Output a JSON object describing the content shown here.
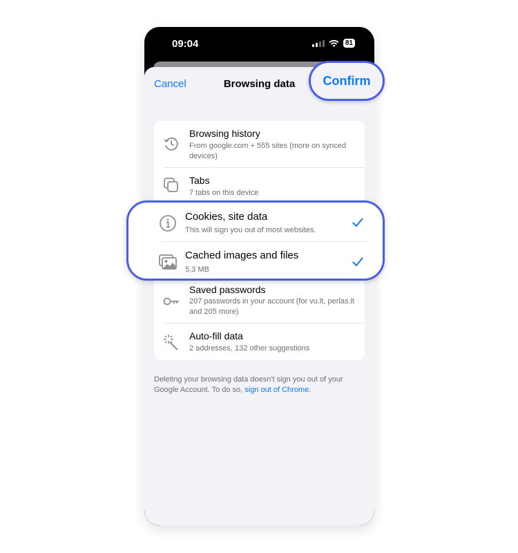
{
  "status_bar": {
    "time": "09:04",
    "battery": "81"
  },
  "nav": {
    "cancel_label": "Cancel",
    "title": "Browsing data",
    "confirm_label": "Confirm"
  },
  "items": [
    {
      "title": "Browsing history",
      "subtitle": "From google.com + 555 sites (more on synced devices)",
      "icon": "history-icon",
      "checked": false
    },
    {
      "title": "Tabs",
      "subtitle": "7 tabs on this device",
      "icon": "tabs-icon",
      "checked": false
    },
    {
      "title": "Cookies, site data",
      "subtitle": "This will sign you out of most websites.",
      "icon": "info-icon",
      "checked": true
    },
    {
      "title": "Cached images and files",
      "subtitle": "5,3 MB",
      "icon": "images-icon",
      "checked": true
    },
    {
      "title": "Saved passwords",
      "subtitle": "207 passwords in your account (for vu.lt, perlas.lt and 205 more)",
      "icon": "key-icon",
      "checked": false
    },
    {
      "title": "Auto-fill data",
      "subtitle": "2 addresses, 132 other suggestions",
      "icon": "magic-wand-icon",
      "checked": false
    }
  ],
  "footer": {
    "text": "Deleting your browsing data doesn't sign you out of your Google Account. To do so,",
    "link": "sign out of Chrome",
    "end": "."
  },
  "colors": {
    "accent": "#0a7aff",
    "highlight": "#4a5de8",
    "background": "#f2f2f7"
  }
}
